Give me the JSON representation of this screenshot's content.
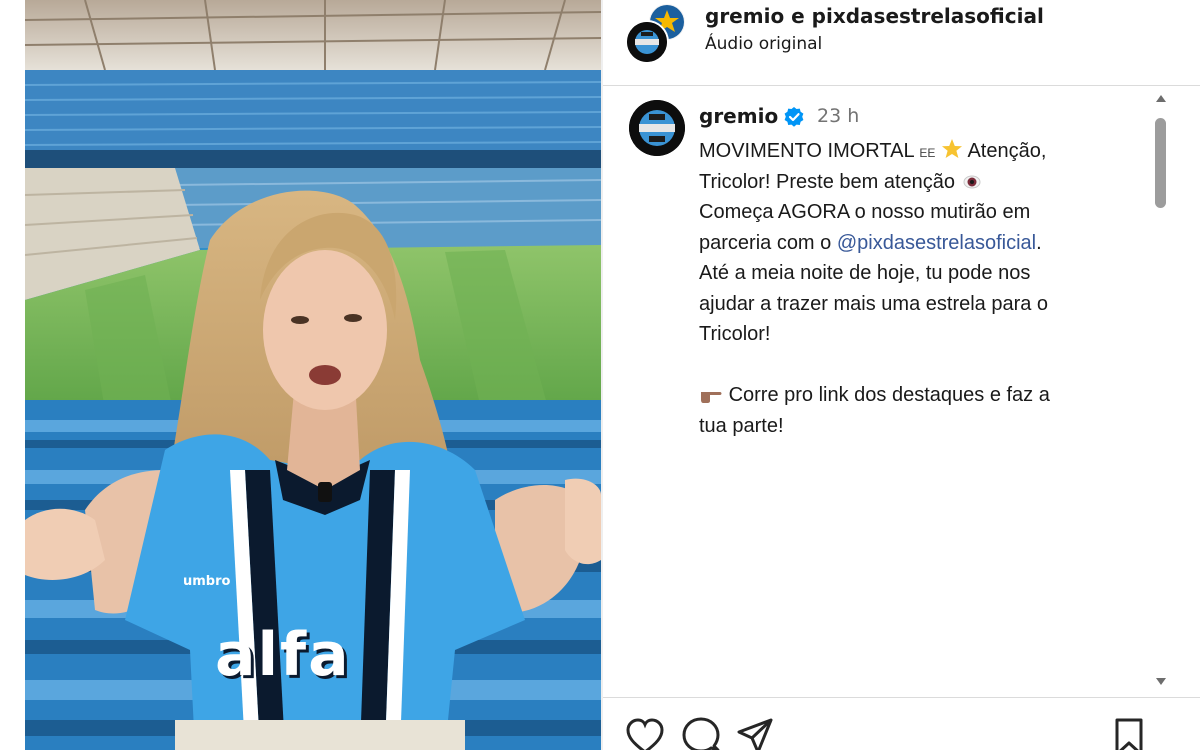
{
  "header": {
    "usernames": "gremio e pixdasestrelasoficial",
    "audio": "Áudio original"
  },
  "media": {
    "jersey_text": "alfa",
    "jersey_brand": "umbro"
  },
  "comment": {
    "username": "gremio",
    "time": "23 h",
    "lines": [
      "MOVIMENTO IMORTAL",
      "Atenção,",
      "Tricolor! Preste bem atenção",
      "Começa AGORA o nosso mutirão em",
      "parceria com o",
      "@pixdasestrelasoficial",
      ".",
      "Até a meia noite de hoje, tu pode nos",
      "ajudar a trazer mais uma estrela para o",
      "Tricolor!",
      "Corre pro link dos destaques e faz a",
      "tua parte!"
    ],
    "inline_glyph": "EE"
  },
  "icons": {
    "verified": "verified-badge-icon",
    "like": "heart-icon",
    "comment": "comment-icon",
    "share": "share-icon",
    "save": "bookmark-icon"
  },
  "colors": {
    "mention": "#385898",
    "verified": "#0095f6",
    "time": "#737373"
  }
}
